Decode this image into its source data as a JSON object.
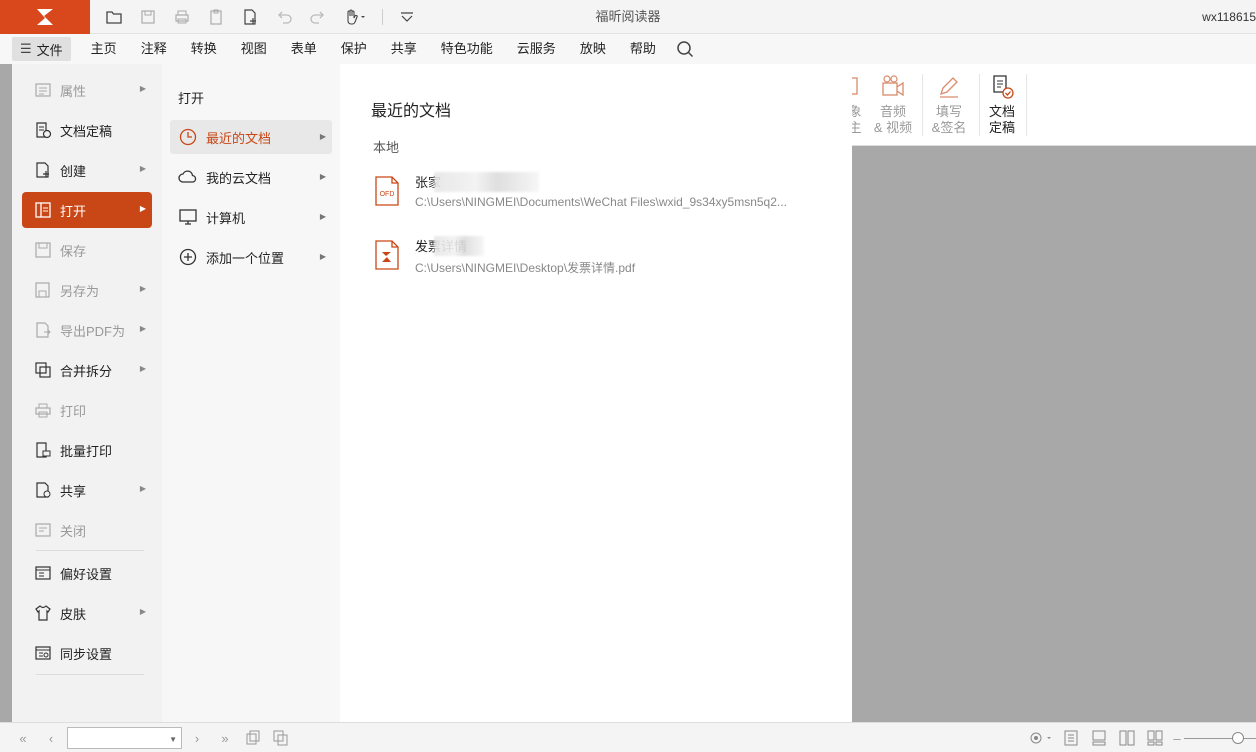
{
  "app": {
    "title": "福昕阅读器",
    "user": "wx118615"
  },
  "menu": {
    "file_label": "文件",
    "items": [
      "主页",
      "注释",
      "转换",
      "视图",
      "表单",
      "保护",
      "共享",
      "特色功能",
      "云服务",
      "放映",
      "帮助"
    ]
  },
  "ribbon": {
    "partial_a": "象",
    "partial_b": "主",
    "audio_line1": "音频",
    "audio_line2": "& 视频",
    "fill_line1": "填写",
    "fill_line2": "&签名",
    "finalize_line1": "文档",
    "finalize_line2": "定稿"
  },
  "left_menu": [
    {
      "label": "属性",
      "icon": "properties-icon",
      "disabled": true,
      "arrow": true
    },
    {
      "label": "文档定稿",
      "icon": "finalize-icon",
      "disabled": false,
      "arrow": false
    },
    {
      "label": "创建",
      "icon": "create-icon",
      "disabled": false,
      "arrow": true
    },
    {
      "label": "打开",
      "icon": "open-icon",
      "disabled": false,
      "arrow": true,
      "active": true
    },
    {
      "label": "保存",
      "icon": "save-icon",
      "disabled": true,
      "arrow": false
    },
    {
      "label": "另存为",
      "icon": "save-as-icon",
      "disabled": true,
      "arrow": true
    },
    {
      "label": "导出PDF为",
      "icon": "export-icon",
      "disabled": true,
      "arrow": true
    },
    {
      "label": "合并拆分",
      "icon": "merge-icon",
      "disabled": false,
      "arrow": true
    },
    {
      "label": "打印",
      "icon": "print-icon",
      "disabled": true,
      "arrow": false
    },
    {
      "label": "批量打印",
      "icon": "batch-print-icon",
      "disabled": false,
      "arrow": false
    },
    {
      "label": "共享",
      "icon": "share-icon",
      "disabled": false,
      "arrow": true
    },
    {
      "label": "关闭",
      "icon": "close-doc-icon",
      "disabled": true,
      "arrow": false
    },
    {
      "label": "偏好设置",
      "icon": "preferences-icon",
      "disabled": false,
      "arrow": false
    },
    {
      "label": "皮肤",
      "icon": "skin-icon",
      "disabled": false,
      "arrow": true
    },
    {
      "label": "同步设置",
      "icon": "sync-icon",
      "disabled": false,
      "arrow": false
    }
  ],
  "open_panel": {
    "title": "打开",
    "items": [
      {
        "label": "最近的文档",
        "icon": "clock-icon",
        "active": true
      },
      {
        "label": "我的云文档",
        "icon": "cloud-icon"
      },
      {
        "label": "计算机",
        "icon": "computer-icon"
      },
      {
        "label": "添加一个位置",
        "icon": "add-location-icon"
      }
    ]
  },
  "recent": {
    "title": "最近的文档",
    "section": "本地",
    "files": [
      {
        "name": "张家",
        "path": "C:\\Users\\NINGMEI\\Documents\\WeChat Files\\wxid_9s34xy5msn5q2...",
        "type": "OFD"
      },
      {
        "name": "发票详情",
        "path": "C:\\Users\\NINGMEI\\Desktop\\发票详情.pdf",
        "type": "PDF"
      }
    ]
  },
  "colors": {
    "accent": "#c94716",
    "logo_bg": "#d9481c"
  }
}
